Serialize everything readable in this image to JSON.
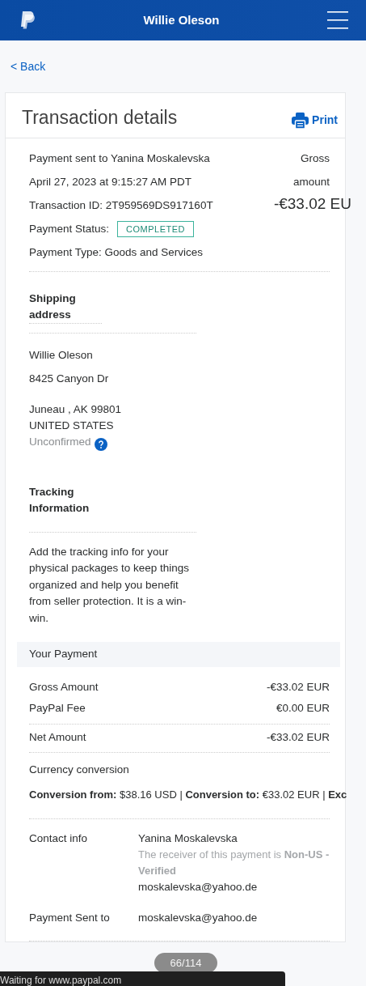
{
  "header": {
    "title": "Willie Oleson"
  },
  "back_link": "< Back",
  "card": {
    "title": "Transaction details",
    "print_label": "Print"
  },
  "summary": {
    "lines": [
      {
        "kind": "text",
        "text": "Payment sent to Yanina Moskalevska"
      },
      {
        "kind": "text",
        "text": "April 27, 2023 at 9:15:27 AM PDT"
      },
      {
        "kind": "text",
        "text": "Transaction ID: 2T959569DS917160T"
      },
      {
        "kind": "status",
        "label": "Payment Status:",
        "badge": "COMPLETED"
      },
      {
        "kind": "text",
        "text": "Payment Type: Goods and Services"
      }
    ],
    "amount_label": "Gross amount",
    "amount": "-€33.02 EU"
  },
  "shipping": {
    "heading": "Shipping address",
    "lines": [
      "Willie Oleson",
      "8425 Canyon Dr"
    ],
    "city_lines": [
      "Juneau , AK 99801",
      "UNITED STATES"
    ],
    "status": "Unconfirmed"
  },
  "tracking": {
    "heading": "Tracking Information",
    "text": "Add the tracking info for your physical packages to keep things organized and help you benefit from seller protection. It is a win-win."
  },
  "payment": {
    "heading": "Your Payment",
    "rows": [
      {
        "kind": "line",
        "label": "Gross Amount",
        "value": "-€33.02 EUR"
      },
      {
        "kind": "line",
        "label": "PayPal Fee",
        "value": "€0.00 EUR"
      },
      {
        "kind": "total",
        "label": "Net Amount",
        "value": "-€33.02 EUR"
      }
    ]
  },
  "conversion": {
    "heading": "Currency conversion",
    "text": "**Conversion from:** $38.16 USD | **Conversion to:** €33.02 EUR | **Exc**"
  },
  "contacts": [
    {
      "label": "Contact info",
      "lines": [
        {
          "kind": "name",
          "text": "Yanina Moskalevska"
        },
        {
          "kind": "note",
          "text": "The receiver of this payment is **Non-US - Verified**"
        },
        {
          "kind": "email",
          "text": "moskalevska@yahoo.de"
        }
      ]
    },
    {
      "label": "Payment Sent to",
      "lines": [
        {
          "kind": "email",
          "text": "moskalevska@yahoo.de"
        }
      ]
    }
  ],
  "page_counter": "66/114",
  "status_bar": "Waiting for www.paypal.com"
}
